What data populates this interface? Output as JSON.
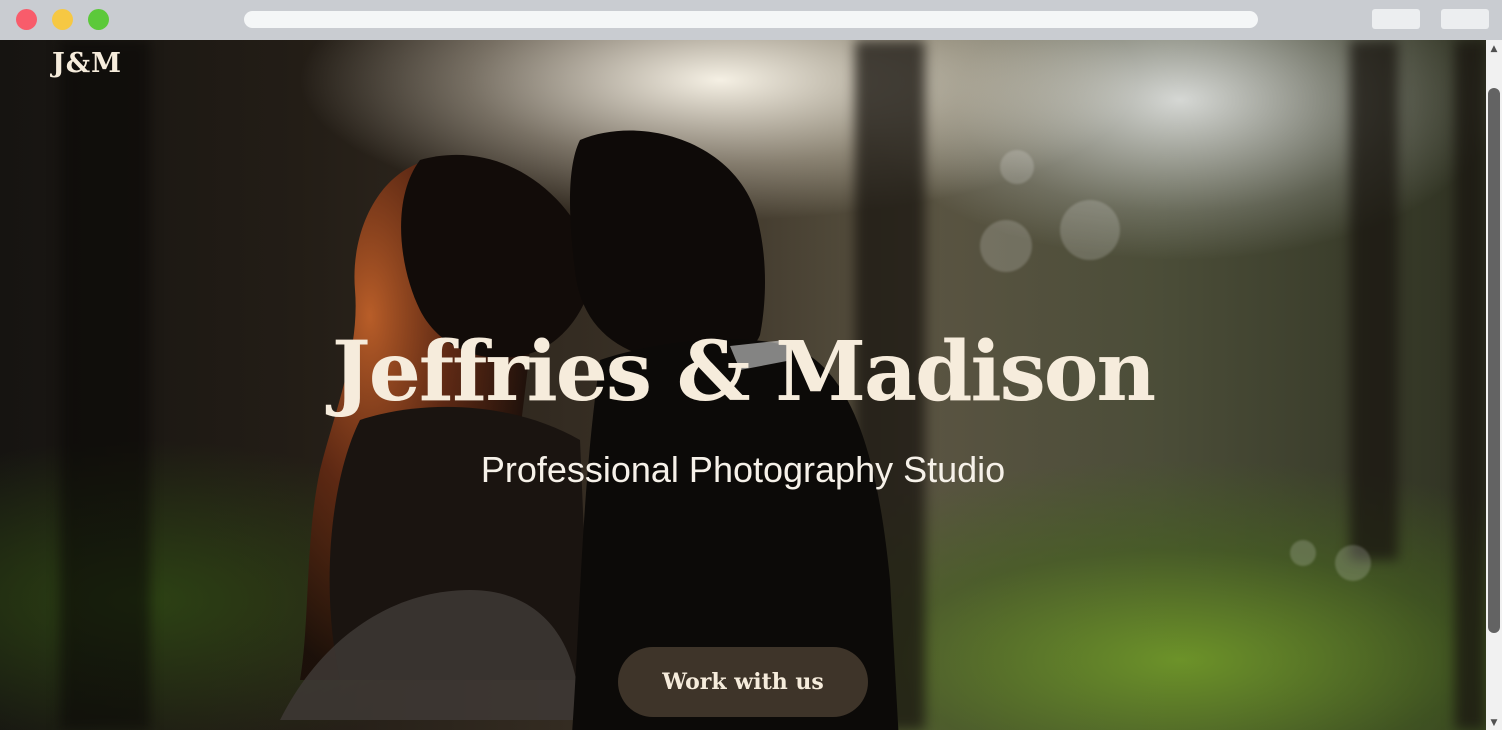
{
  "site": {
    "logo": "J&M",
    "hero_title": "Jeffries & Madison",
    "hero_subtitle": "Professional Photography Studio",
    "cta_label": "Work with us"
  },
  "scrollbar": {
    "up_glyph": "▲",
    "down_glyph": "▼"
  },
  "colors": {
    "text_cream": "#f6ecdc",
    "button_bg": "#463a2e",
    "chrome_bg": "#c9ccd1",
    "close_dot": "#f85c6b",
    "minimize_dot": "#f6c843",
    "maximize_dot": "#5cc93a"
  }
}
